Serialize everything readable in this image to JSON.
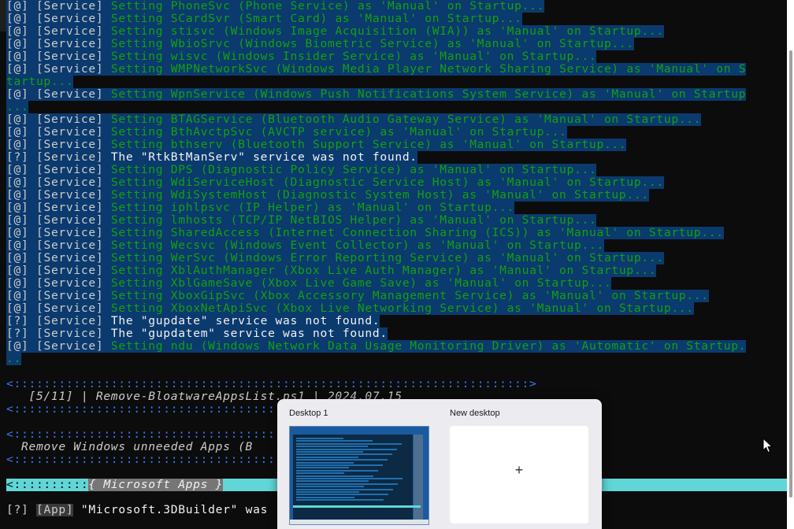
{
  "terminal": {
    "service_lines": [
      {
        "tag": "[@]",
        "cat": "[Service]",
        "msg": "Setting PhoneSvc (Phone Service) as 'Manual' on Startup...",
        "kind": "green"
      },
      {
        "tag": "[@]",
        "cat": "[Service]",
        "msg": "Setting SCardSvr (Smart Card) as 'Manual' on Startup...",
        "kind": "green"
      },
      {
        "tag": "[@]",
        "cat": "[Service]",
        "msg": "Setting stisvc (Windows Image Acquisition (WIA)) as 'Manual' on Startup...",
        "kind": "green"
      },
      {
        "tag": "[@]",
        "cat": "[Service]",
        "msg": "Setting WbioSrvc (Windows Biometric Service) as 'Manual' on Startup...",
        "kind": "green"
      },
      {
        "tag": "[@]",
        "cat": "[Service]",
        "msg": "Setting wisvc (Windows Insider Service) as 'Manual' on Startup...",
        "kind": "green"
      },
      {
        "tag": "[@]",
        "cat": "[Service]",
        "msg": "Setting WMPNetworkSvc (Windows Media Player Network Sharing Service) as 'Manual' on S",
        "kind": "green"
      },
      {
        "tag": "",
        "cat": "",
        "msg": "tartup...",
        "kind": "green-wrap"
      },
      {
        "tag": "[@]",
        "cat": "[Service]",
        "msg": "Setting WpnService (Windows Push Notifications System Service) as 'Manual' on Startup",
        "kind": "green"
      },
      {
        "tag": "",
        "cat": "",
        "msg": "...",
        "kind": "green-wrap"
      },
      {
        "tag": "[@]",
        "cat": "[Service]",
        "msg": "Setting BTAGService (Bluetooth Audio Gateway Service) as 'Manual' on Startup...",
        "kind": "green"
      },
      {
        "tag": "[@]",
        "cat": "[Service]",
        "msg": "Setting BthAvctpSvc (AVCTP service) as 'Manual' on Startup...",
        "kind": "green"
      },
      {
        "tag": "[@]",
        "cat": "[Service]",
        "msg": "Setting bthserv (Bluetooth Support Service) as 'Manual' on Startup...",
        "kind": "green"
      },
      {
        "tag": "[?]",
        "cat": "[Service]",
        "msg": "The \"RtkBtManServ\" service was not found.",
        "kind": "white"
      },
      {
        "tag": "[@]",
        "cat": "[Service]",
        "msg": "Setting DPS (Diagnostic Policy Service) as 'Manual' on Startup...",
        "kind": "green"
      },
      {
        "tag": "[@]",
        "cat": "[Service]",
        "msg": "Setting WdiServiceHost (Diagnostic Service Host) as 'Manual' on Startup...",
        "kind": "green"
      },
      {
        "tag": "[@]",
        "cat": "[Service]",
        "msg": "Setting WdiSystemHost (Diagnostic System Host) as 'Manual' on Startup...",
        "kind": "green"
      },
      {
        "tag": "[@]",
        "cat": "[Service]",
        "msg": "Setting iphlpsvc (IP Helper) as 'Manual' on Startup...",
        "kind": "green"
      },
      {
        "tag": "[@]",
        "cat": "[Service]",
        "msg": "Setting lmhosts (TCP/IP NetBIOS Helper) as 'Manual' on Startup...",
        "kind": "green"
      },
      {
        "tag": "[@]",
        "cat": "[Service]",
        "msg": "Setting SharedAccess (Internet Connection Sharing (ICS)) as 'Manual' on Startup...",
        "kind": "green"
      },
      {
        "tag": "[@]",
        "cat": "[Service]",
        "msg": "Setting Wecsvc (Windows Event Collector) as 'Manual' on Startup...",
        "kind": "green"
      },
      {
        "tag": "[@]",
        "cat": "[Service]",
        "msg": "Setting WerSvc (Windows Error Reporting Service) as 'Manual' on Startup...",
        "kind": "green"
      },
      {
        "tag": "[@]",
        "cat": "[Service]",
        "msg": "Setting XblAuthManager (Xbox Live Auth Manager) as 'Manual' on Startup...",
        "kind": "green"
      },
      {
        "tag": "[@]",
        "cat": "[Service]",
        "msg": "Setting XblGameSave (Xbox Live Game Save) as 'Manual' on Startup...",
        "kind": "green"
      },
      {
        "tag": "[@]",
        "cat": "[Service]",
        "msg": "Setting XboxGipSvc (Xbox Accessory Management Service) as 'Manual' on Startup...",
        "kind": "green"
      },
      {
        "tag": "[@]",
        "cat": "[Service]",
        "msg": "Setting XboxNetApiSvc (Xbox Live Networking Service) as 'Manual' on Startup...",
        "kind": "green"
      },
      {
        "tag": "[?]",
        "cat": "[Service]",
        "msg": "The \"gupdate\" service was not found.",
        "kind": "white"
      },
      {
        "tag": "[?]",
        "cat": "[Service]",
        "msg": "The \"gupdatem\" service was not found.",
        "kind": "white"
      },
      {
        "tag": "[@]",
        "cat": "[Service]",
        "msg": "Setting ndu (Windows Network Data Usage Monitoring Driver) as 'Automatic' on Startup.",
        "kind": "green"
      },
      {
        "tag": "",
        "cat": "",
        "msg": "..",
        "kind": "green-wrap"
      }
    ],
    "divider_1": "<:::::::::::::::::::::::::::::::::::::::::::::::::::::::::::::::::::::>",
    "script_header": "   [5/11] | Remove-BloatwareAppsList.ps1 | 2024.07.15",
    "divider_2": "<::::::::::::::::::::::::::::::::::::::::::::",
    "divider_3": "<::::::::::::::::::::::::::::::::::::::::::::",
    "section_title": "  Remove Windows unneeded Apps (B",
    "divider_4": "<::::::::::::::::::::::::::::::::::::::::::::",
    "apps_band_left": "<::::::::::",
    "apps_band_title": "{ Microsoft Apps }",
    "app_line": {
      "tag": "[?]",
      "cat": "[App]",
      "msg": "\"Microsoft.3DBuilder\" was"
    }
  },
  "task_view": {
    "desktop1_label": "Desktop 1",
    "new_desktop_label": "New desktop",
    "plus_glyph": "+"
  },
  "colors": {
    "terminal_bg": "#0c0c0c",
    "selection": "#0b3a6e",
    "green_text": "#13a10e",
    "cyan_band": "#61d6d6",
    "blue_divider": "#3b78ff"
  }
}
